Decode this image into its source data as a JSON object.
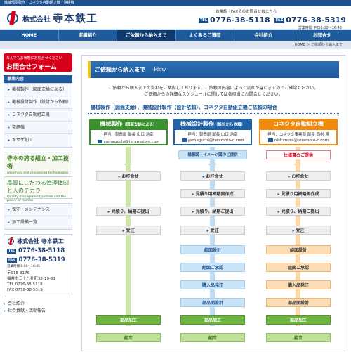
{
  "topbar": {
    "text": "機械部品製作・コネクタ自動組立機・整経機"
  },
  "header": {
    "company_kabu": "株式会社",
    "company_name": "寺本鉄工",
    "contact_note": "お電話・FAXでのお問合せはこちら",
    "tel_label": "TEL",
    "tel": "0776-38-5118",
    "fax_label": "FAX",
    "fax": "0776-38-5319",
    "hours": "営業時間 平日8:00〜16:45"
  },
  "nav": {
    "items": [
      {
        "label": "HOME"
      },
      {
        "label": "実績紹介"
      },
      {
        "label": "ご依頼から納入まで"
      },
      {
        "label": "よくあるご質問"
      },
      {
        "label": "会社紹介"
      },
      {
        "label": "お問合せ"
      }
    ]
  },
  "breadcrumb": {
    "text": "HOME ＞ ご依頼から納入まで"
  },
  "sidebar": {
    "inquiry_small": "なんでもお気軽にお問合せください",
    "inquiry_big": "お問合せフォーム",
    "section_title": "事業内容",
    "items": [
      {
        "label": "機械製作（図面支給による）"
      },
      {
        "label": "機械設計製作（設計から依頼）"
      },
      {
        "label": "コネクタ自動組立機"
      },
      {
        "label": "整経機"
      },
      {
        "label": "キサゲ加工"
      }
    ],
    "banner1_title": "寺本の誇る組立・加工技術",
    "banner1_sub": "Assembly and processing technologies",
    "banner2_title": "品質にこだわる管理体制と人のチカラ",
    "banner2_sub": "Quality management system and the power of human",
    "items2": [
      {
        "label": "保守・メンテナンス"
      },
      {
        "label": "加工設備一覧"
      }
    ],
    "company": {
      "kabu": "株式会社",
      "name": "寺本鉄工",
      "tel_label": "TEL",
      "tel": "0776-38-5118",
      "fax_label": "FAX",
      "fax": "0776-38-5319",
      "hours": "営業時間 8:00〜16:45",
      "zip": "〒918-8176",
      "address": "福井市三十八社町32-19-31",
      "tel_line": "TEL 0776-38-5118",
      "fax_line": "FAX 0776-38-5319"
    },
    "bottom_items": [
      {
        "label": "会社紹介"
      },
      {
        "label": "社会貢献・活動報告"
      }
    ]
  },
  "main": {
    "title": "ご依頼から納入まで",
    "title_en": "Flow",
    "intro1": "ご依頼から納入までの流れをご案内しております。ご依頼の内容によって流れが違いますのでご確認ください。",
    "intro2": "ご依頼からの詳細なスケジュールに関しては各担当にお問合せください。",
    "subhead": "機械製作（図面支給）、機械設計製作（設計依頼）、コネクタ自動組立機ご依頼の場合",
    "columns": [
      {
        "title": "機械製作",
        "title_small": "（図面支給による）",
        "staff": "担当：製造部 部長 山口 浩幸",
        "email": "yamaguchi@teramoto-c.com"
      },
      {
        "title": "機械設計製作",
        "title_small": "（設計から依頼）",
        "staff": "担当：製造部 部長 山口 浩幸",
        "email": "yamaguchi@teramoto-c.com"
      },
      {
        "title": "コネクタ自動組立機",
        "title_small": "",
        "staff": "担当：コネクタ事業部 部長 西村 博",
        "email": "nishimura@teramoto-c.com"
      }
    ],
    "steps": {
      "col1": [
        "お打合せ",
        "見積り、納期ご提出",
        "受注",
        "部品加工",
        "組立"
      ],
      "col2": [
        "構想図・イメージ図のご提供",
        "お打合せ",
        "見積り用概略図作成",
        "見積り、納期ご提出",
        "受注",
        "組図設計",
        "組図ご承認",
        "購入品発注",
        "部品図設計",
        "部品加工",
        "組立"
      ],
      "col3": [
        "仕様書のご提供",
        "お打合せ",
        "見積り用概略図作成",
        "見積り、納期ご提出",
        "受注",
        "組図設計",
        "組図ご承認",
        "購入品発注",
        "部品図設計",
        "部品加工",
        "組立"
      ]
    }
  },
  "colors": {
    "brand_blue": "#1e5a9c",
    "accent_red": "#d6001c",
    "col_green": "#3a8f2e",
    "col_blue": "#2062a8",
    "col_orange": "#ef8a0d"
  }
}
